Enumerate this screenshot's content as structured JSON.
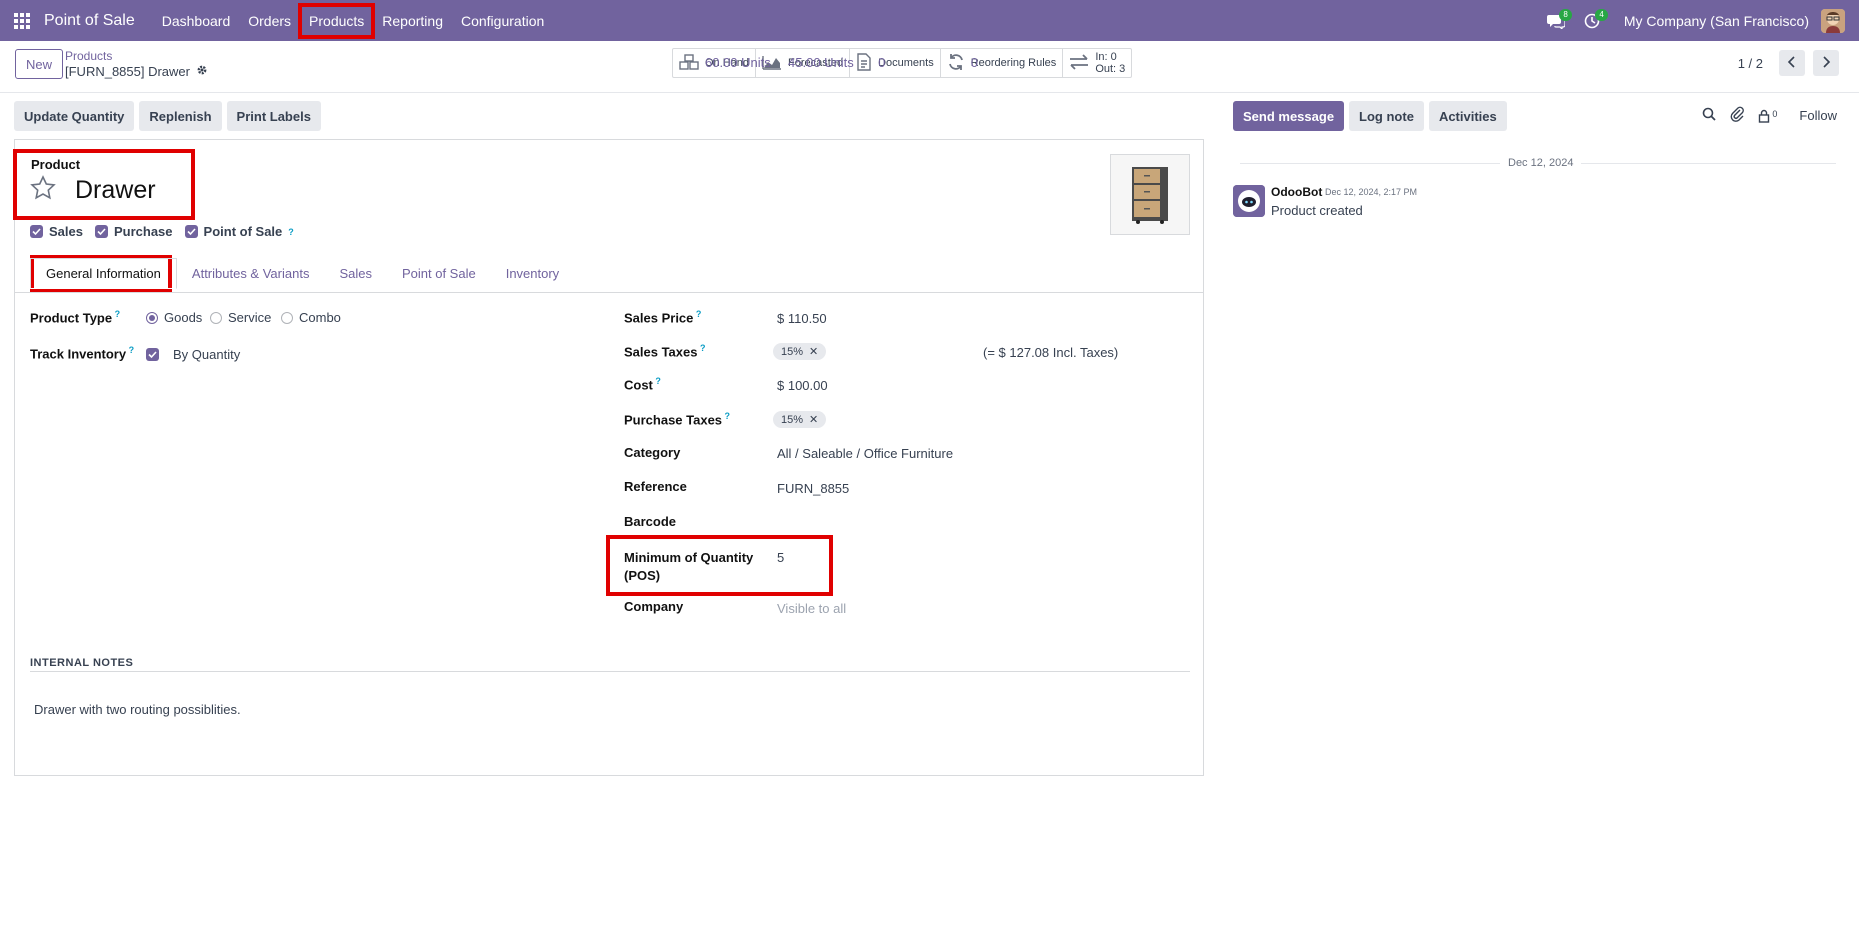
{
  "navbar": {
    "app_title": "Point of Sale",
    "menu": [
      "Dashboard",
      "Orders",
      "Products",
      "Reporting",
      "Configuration"
    ],
    "active_menu": "Products",
    "messages_count": "8",
    "activities_count": "4",
    "company": "My Company (San Francisco)"
  },
  "control_panel": {
    "new_label": "New",
    "breadcrumb_parent": "Products",
    "breadcrumb_current": "[FURN_8855] Drawer",
    "smart_buttons": [
      {
        "label": "On Hand",
        "value": "60.00 Units",
        "icon": "cubes-icon"
      },
      {
        "label": "Forecasted",
        "value": "45.00 Units",
        "icon": "area-chart-icon"
      },
      {
        "label": "Documents",
        "value": "0",
        "icon": "file-icon"
      },
      {
        "label": "Reordering Rules",
        "value": "0",
        "icon": "refresh-icon"
      },
      {
        "label": "In: 0",
        "value": "Out: 3",
        "icon": "exchange-icon"
      }
    ],
    "pager": "1 / 2"
  },
  "actions": [
    "Update Quantity",
    "Replenish",
    "Print Labels"
  ],
  "form": {
    "product_label": "Product",
    "product_name": "Drawer",
    "checks": [
      "Sales",
      "Purchase",
      "Point of Sale"
    ],
    "tabs": [
      "General Information",
      "Attributes & Variants",
      "Sales",
      "Point of Sale",
      "Inventory"
    ],
    "active_tab": "General Information",
    "left": {
      "product_type_label": "Product Type",
      "product_type_options": [
        "Goods",
        "Service",
        "Combo"
      ],
      "product_type_selected": "Goods",
      "track_inventory_label": "Track Inventory",
      "track_inventory_value": "By Quantity"
    },
    "right": {
      "sales_price_label": "Sales Price",
      "sales_price": "$ 110.50",
      "sales_taxes_label": "Sales Taxes",
      "sales_taxes_tag": "15%",
      "sales_taxes_incl": "(= $ 127.08 Incl. Taxes)",
      "cost_label": "Cost",
      "cost": "$ 100.00",
      "purchase_taxes_label": "Purchase Taxes",
      "purchase_taxes_tag": "15%",
      "category_label": "Category",
      "category": "All / Saleable / Office Furniture",
      "reference_label": "Reference",
      "reference": "FURN_8855",
      "barcode_label": "Barcode",
      "min_qty_label_1": "Minimum of Quantity",
      "min_qty_label_2": "(POS)",
      "min_qty": "5",
      "company_label": "Company",
      "company_placeholder": "Visible to all"
    },
    "notes_title": "INTERNAL NOTES",
    "notes_text": "Drawer with two routing possiblities."
  },
  "chatter": {
    "buttons": [
      "Send message",
      "Log note",
      "Activities"
    ],
    "follower_count": "0",
    "follow_label": "Follow",
    "date_separator": "Dec 12, 2024",
    "message": {
      "author": "OdooBot",
      "date": "Dec 12, 2024, 2:17 PM",
      "body": "Product created"
    }
  }
}
